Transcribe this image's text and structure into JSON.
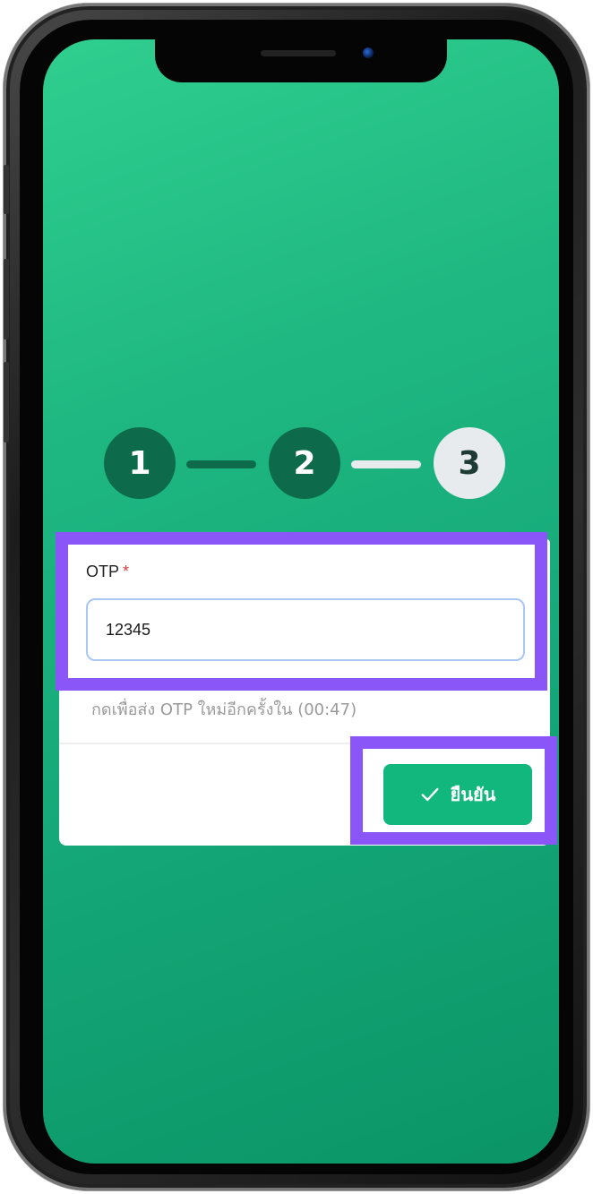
{
  "stepper": {
    "steps": [
      {
        "number": "1",
        "state": "done"
      },
      {
        "number": "2",
        "state": "done"
      },
      {
        "number": "3",
        "state": "current"
      }
    ]
  },
  "otp_form": {
    "label": "OTP",
    "required_marker": "*",
    "value": "12345",
    "resend_text": "กดเพื่อส่ง OTP ใหม่อีกครั้งใน (00:47)"
  },
  "actions": {
    "confirm_label": "ยืนยัน"
  },
  "colors": {
    "screen_gradient_start": "#2fcf8f",
    "screen_gradient_end": "#0b9566",
    "step_done": "#0d6b4c",
    "step_pending": "#e8ebee",
    "confirm_button": "#12b77e",
    "highlight": "#8a56f7",
    "required_star": "#e03a3a"
  },
  "icons": {
    "confirm": "check-icon"
  }
}
